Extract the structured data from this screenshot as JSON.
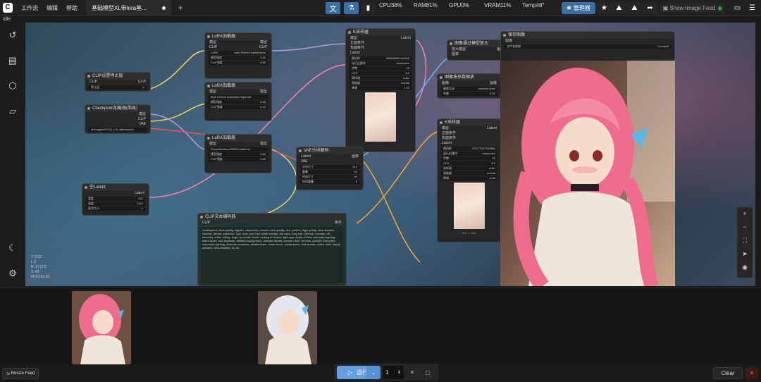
{
  "topbar": {
    "menu": [
      "工作流",
      "编辑",
      "帮助"
    ],
    "tab_title": "基础模型XL带lora基...",
    "cpu": "CPU38%",
    "ram": "RAM81%",
    "gpu": "GPU0%",
    "vram": "VRAM11%",
    "temp": "Temp48°",
    "manager_label": "管理器",
    "show_feed_label": "Show Image Feed"
  },
  "status": "Idle",
  "nodes": {
    "lora1": {
      "title": "LoRA加载器",
      "in1": "模型",
      "in2": "CLIP",
      "lora": "LoRA",
      "lora_val": "futur-000010.safetensors",
      "m_label": "模型强度",
      "m_val": "1.00",
      "c_label": "CLIP强度",
      "c_val": "0.85"
    },
    "lora2": {
      "title": "LoRA加载器",
      "lora_val": "Blue Archive Animation Style.saf",
      "m_label": "模型强度",
      "m_val": "0.35",
      "c_label": "CLIP强度",
      "c_val": "0.10"
    },
    "lora3": {
      "title": "LoRA加载器",
      "lora_val": "Ronyettoretsu-000009.safetens",
      "m_label": "模型强度",
      "m_val": "0.80",
      "c_label": "CLIP强度",
      "c_val": "0.85"
    },
    "clipskip": {
      "title": "CLIP设置停止层",
      "in": "CLIP",
      "out": "CLIP",
      "field": "停止层",
      "val": "-2"
    },
    "ckpt": {
      "title": "Checkpoint加载器(简易)",
      "out1": "模型",
      "out2": "CLIP",
      "out3": "VAE",
      "val": "animagineXLV31_v31.safetensors"
    },
    "latent": {
      "title": "空Latent",
      "out": "Latent",
      "w_label": "宽度",
      "w_val": "832",
      "h_label": "高度",
      "h_val": "1344",
      "b_label": "批次大小",
      "b_val": "1"
    },
    "ksampler1": {
      "title": "K采样器",
      "in1": "模型",
      "in2": "正面条件",
      "in3": "负面条件",
      "in4": "Latent",
      "out": "Latent",
      "seed_label": "随机种",
      "seed_val": "560005081446565",
      "ctrl_label": "运行后操作",
      "ctrl_val": "randomize",
      "steps_label": "步数",
      "steps_val": "20",
      "cfg_label": "CFG",
      "cfg_val": "6.0",
      "sampler_label": "采样器",
      "sampler_val": "euler",
      "sched_label": "调度器",
      "sched_val": "normal",
      "denoise_label": "降噪",
      "denoise_val": "1.00"
    },
    "vaeenc": {
      "title": "VAE分块解码",
      "in1": "Latent",
      "in2": "VAE",
      "out": "图像",
      "t_label": "分块尺寸",
      "t_val": "512",
      "o_label": "重叠",
      "o_val": "64",
      "tt_label": "时间尺寸",
      "tt_val": "64",
      "to_label": "时间重叠",
      "to_val": "8"
    },
    "upscale_model": {
      "title": "图像通过模型放大",
      "in1": "放大模型",
      "in2": "图像",
      "out": "图像"
    },
    "scale": {
      "title": "图像按系数缩放",
      "in": "图像",
      "out": "图像",
      "m_label": "缩放方法",
      "m_val": "nearest-exact",
      "s_label": "系数",
      "s_val": "0.50"
    },
    "ksampler2": {
      "title": "K采样器",
      "out": "Latent",
      "seed_val": "220375287920862",
      "ctrl_val": "randomize",
      "steps_val": "20",
      "cfg_val": "6.0",
      "sampler_val": "euler",
      "sched_val": "normal",
      "denoise_val": "0.35",
      "caption": "832 × 1344"
    },
    "save": {
      "title": "保存图像",
      "in": "图像",
      "prefix_label": "文件名前缀",
      "prefix_val": "ComfyUI"
    },
    "textenc": {
      "title": "CLIP文本编码器",
      "in": "CLIP",
      "out": "条件",
      "text": "masterpiece, best quality, highres, absurdres, newest, best quality, rich, perfect, high quality, ultra-detailed, colorful, vibrant, aesthetic, 1girl, solo, pink hair, white streaks, red eyes, long hair, drill hair, sweater, off-shoulder, collar, sitting, finger to mouth, blush, looking at viewer, light rays, depth of field, cinematic lighting, warm tones, soft shadows, detailed background, intricate details, wooden floor, window, sunlight, film grain, volumetric lighting, dramatic shadows, detailed face, sharp focus, masterpiece, best quality, anime style, highly detailed, ultra-detailed, 4k, 8k"
    }
  },
  "canvas_info": {
    "t": "T: 0.02",
    "i": "I: 0",
    "n": "N: 17 [17]",
    "v": "V: 45",
    "fps": "FPS:181.82"
  },
  "bottombar": {
    "resize_feed": "Resize Feed",
    "run_label": "运行",
    "batch": "1",
    "clear": "Clear"
  }
}
